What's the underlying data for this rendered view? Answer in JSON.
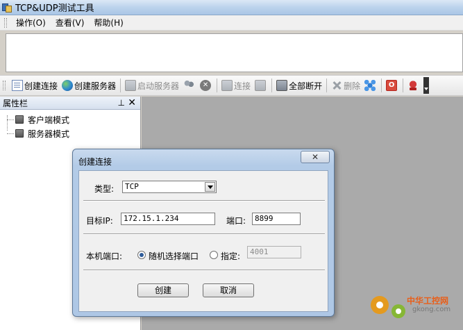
{
  "window": {
    "title": "TCP&UDP测试工具"
  },
  "menu": {
    "items": [
      "操作(O)",
      "查看(V)",
      "帮助(H)"
    ]
  },
  "toolbar": {
    "create_connection": "创建连接",
    "create_server": "创建服务器",
    "start_server": "启动服务器",
    "connect": "连接",
    "disconnect_all": "全部断开",
    "delete": "删除"
  },
  "panel": {
    "title": "属性栏",
    "pin_icon": "⊥",
    "close_icon": "✕",
    "tree": [
      "客户端模式",
      "服务器模式"
    ]
  },
  "dialog": {
    "title": "创建连接",
    "close_label": "✕",
    "type_label": "类型:",
    "type_value": "TCP",
    "target_ip_label": "目标IP:",
    "target_ip_value": "172.15.1.234",
    "port_label": "端口:",
    "port_value": "8899",
    "local_port_label": "本机端口:",
    "random_port_label": "随机选择端口",
    "specify_label": "指定:",
    "specify_value": "4001",
    "create_button": "创建",
    "cancel_button": "取消"
  },
  "watermark": {
    "cn": "中华工控网",
    "en": "gkong.com"
  },
  "colors": {
    "workarea": "#aaaaaa",
    "dialog_frame": "#aec7e5",
    "accent": "#2e5c9a"
  }
}
